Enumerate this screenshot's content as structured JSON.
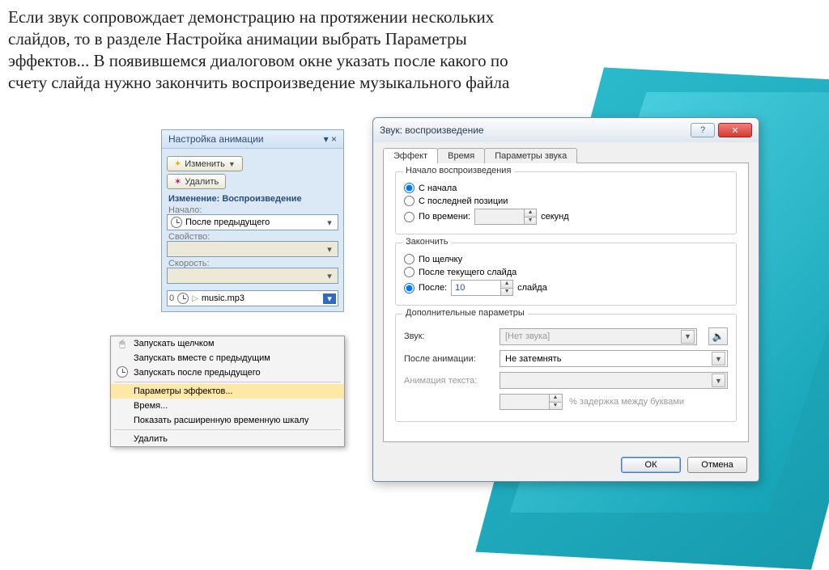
{
  "instruction": "Если звук сопровождает демонстрацию на протяжении нескольких слайдов, то в разделе Настройка анимации выбрать Параметры эффектов... В появившемся диалоговом окне указать после какого по счету слайда нужно закончить воспроизведение музыкального файла",
  "anim_pane": {
    "title": "Настройка анимации",
    "change_btn": "Изменить",
    "remove_btn": "Удалить",
    "section_change": "Изменение: Воспроизведение",
    "start_label": "Начало:",
    "start_value": "После предыдущего",
    "property_label": "Свойство:",
    "speed_label": "Скорость:",
    "item_index": "0",
    "item_file": "music.mp3"
  },
  "context_menu": {
    "items": [
      "Запускать щелчком",
      "Запускать вместе с предыдущим",
      "Запускать после предыдущего",
      "Параметры эффектов...",
      "Время...",
      "Показать расширенную временную шкалу",
      "Удалить"
    ]
  },
  "dialog": {
    "title": "Звук: воспроизведение",
    "tabs": [
      "Эффект",
      "Время",
      "Параметры звука"
    ],
    "group_start": "Начало воспроизведения",
    "start_opts": {
      "begin": "С начала",
      "last": "С последней позиции",
      "time": "По времени:",
      "time_unit": "секунд"
    },
    "group_stop": "Закончить",
    "stop_opts": {
      "click": "По щелчку",
      "current": "После текущего слайда",
      "after": "После:",
      "after_value": "10",
      "after_unit": "слайда"
    },
    "group_extra": "Дополнительные параметры",
    "extra": {
      "sound_label": "Звук:",
      "sound_value": "[Нет звука]",
      "after_anim_label": "После анимации:",
      "after_anim_value": "Не затемнять",
      "text_anim_label": "Анимация текста:",
      "delay_label": "% задержка между буквами"
    },
    "ok": "ОК",
    "cancel": "Отмена"
  }
}
